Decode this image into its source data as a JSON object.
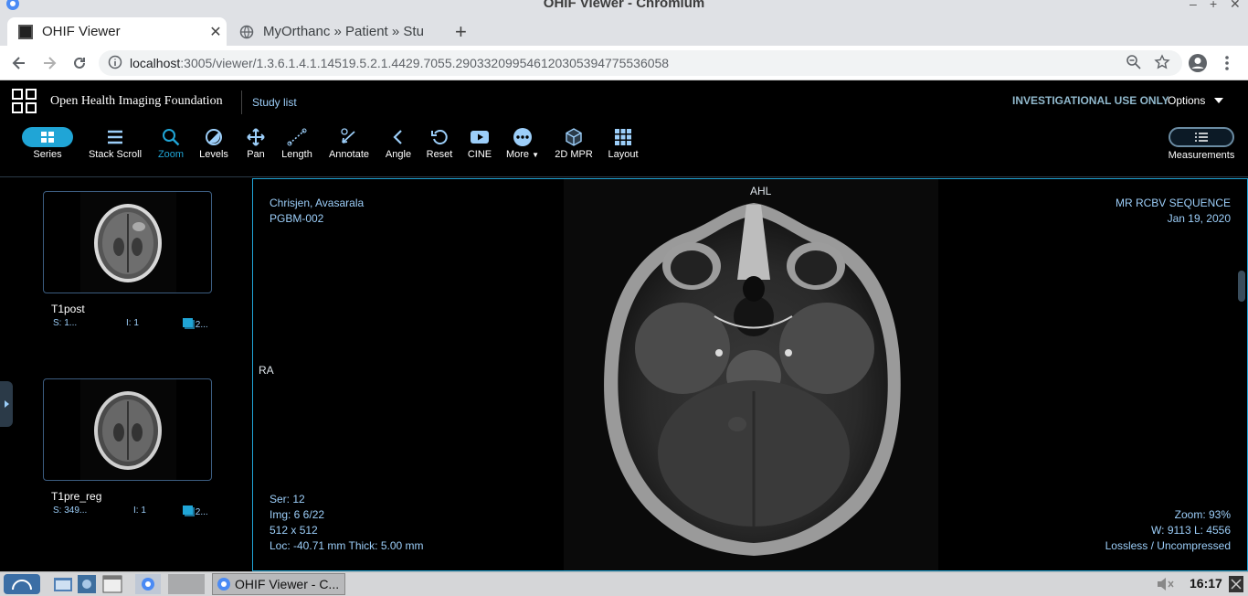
{
  "window": {
    "title": "OHIF Viewer - Chromium",
    "minimize": "–",
    "maximize": "+",
    "close": "✕"
  },
  "tabs": [
    {
      "label": "OHIF Viewer",
      "close": "✕"
    },
    {
      "label": "MyOrthanc » Patient » Stu"
    }
  ],
  "newtab": "+",
  "address": {
    "host": "localhost",
    "path": ":3005/viewer/1.3.6.1.4.1.14519.5.2.1.4429.7055.290332099546120305394775536058"
  },
  "header": {
    "brand": "Open Health Imaging Foundation",
    "study_list": "Study list",
    "investigational": "INVESTIGATIONAL USE ONLY",
    "options": "Options"
  },
  "toolbar": {
    "series": "Series",
    "stack_scroll": "Stack Scroll",
    "zoom": "Zoom",
    "levels": "Levels",
    "pan": "Pan",
    "length": "Length",
    "annotate": "Annotate",
    "angle": "Angle",
    "reset": "Reset",
    "cine": "CINE",
    "more": "More",
    "mpr": "2D MPR",
    "layout": "Layout",
    "measurements": "Measurements"
  },
  "series_list": [
    {
      "label": "T1post",
      "s": "S: 1...",
      "i": "I: 1",
      "count": "2..."
    },
    {
      "label": "T1pre_reg",
      "s": "S: 349...",
      "i": "I: 1",
      "count": "2..."
    }
  ],
  "viewport": {
    "patient_name": "Chrisjen, Avasarala",
    "patient_id": "PGBM-002",
    "series_desc": "MR RCBV SEQUENCE",
    "study_date": "Jan 19, 2020",
    "orient_top": "AHL",
    "orient_left": "RA",
    "ser": "Ser: 12",
    "img": "Img: 6 6/22",
    "dims": "512 x 512",
    "loc": "Loc: -40.71 mm Thick: 5.00 mm",
    "zoom": "Zoom: 93%",
    "wl": "W: 9113 L: 4556",
    "compression": "Lossless / Uncompressed"
  },
  "taskbar": {
    "window_label": "OHIF Viewer - C...",
    "clock": "16:17"
  },
  "colors": {
    "accent": "#20a5d6",
    "overlay_text": "#9ccef9",
    "background": "#000000"
  }
}
